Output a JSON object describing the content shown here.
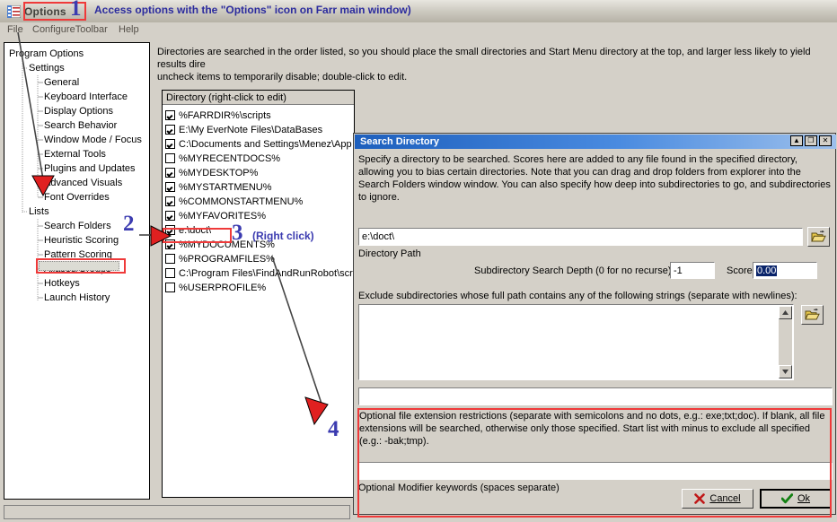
{
  "toolbar": {
    "options_label": "Options",
    "options_icon": "checklist-options-icon"
  },
  "annotations": {
    "one": {
      "number": "1",
      "text": "Access options with the \"Options\" icon on Farr main window)"
    },
    "two": {
      "number": "2"
    },
    "three": {
      "number": "3",
      "text": "(Right click)"
    },
    "four": {
      "number": "4"
    }
  },
  "menubar": {
    "items": [
      {
        "label": "File"
      },
      {
        "label": "ConfigureToolbar"
      },
      {
        "label": "Help"
      }
    ]
  },
  "tree": {
    "nodes": [
      {
        "label": "Program Options",
        "depth": 0
      },
      {
        "label": "Settings",
        "depth": 1
      },
      {
        "label": "General",
        "depth": 2
      },
      {
        "label": "Keyboard Interface",
        "depth": 2
      },
      {
        "label": "Display Options",
        "depth": 2
      },
      {
        "label": "Search Behavior",
        "depth": 2
      },
      {
        "label": "Window Mode / Focus",
        "depth": 2
      },
      {
        "label": "External Tools",
        "depth": 2
      },
      {
        "label": "Plugins and Updates",
        "depth": 2
      },
      {
        "label": "Advanced Visuals",
        "depth": 2
      },
      {
        "label": "Font Overrides",
        "depth": 2
      },
      {
        "label": "Lists",
        "depth": 1
      },
      {
        "label": "Search Folders",
        "depth": 2
      },
      {
        "label": "Heuristic Scoring",
        "depth": 2
      },
      {
        "label": "Pattern Scoring",
        "depth": 2
      },
      {
        "label": "Aliases/Groups",
        "depth": 2
      },
      {
        "label": "Hotkeys",
        "depth": 2
      },
      {
        "label": "Launch History",
        "depth": 2
      }
    ],
    "selected": "Search Folders"
  },
  "main": {
    "description": "Directories are searched in the order listed, so you should place the small directories and Start Menu directory at the top, and larger less likely to yield results dire",
    "description_line2": "uncheck items to temporarily disable; double-click to edit.",
    "dirlist_header": "Directory (right-click to edit)",
    "directories": [
      {
        "label": "%FARRDIR%\\scripts",
        "checked": true
      },
      {
        "label": "E:\\My EverNote Files\\DataBases",
        "checked": true
      },
      {
        "label": "C:\\Documents and Settings\\Menez\\App",
        "checked": true
      },
      {
        "label": "%MYRECENTDOCS%",
        "checked": false
      },
      {
        "label": "%MYDESKTOP%",
        "checked": true
      },
      {
        "label": "%MYSTARTMENU%",
        "checked": true
      },
      {
        "label": "%COMMONSTARTMENU%",
        "checked": true
      },
      {
        "label": "%MYFAVORITES%",
        "checked": true
      },
      {
        "label": "e:\\doct\\",
        "checked": true
      },
      {
        "label": "%MYDOCUMENTS%",
        "checked": true
      },
      {
        "label": "%PROGRAMFILES%",
        "checked": false
      },
      {
        "label": "C:\\Program Files\\FindAndRunRobot\\scr",
        "checked": false
      },
      {
        "label": "%USERPROFILE%",
        "checked": false
      }
    ]
  },
  "dialog": {
    "title": "Search Directory",
    "titlebar_buttons": [
      {
        "name": "rollup-icon",
        "glyph": "▲"
      },
      {
        "name": "pin-icon",
        "glyph": "❐"
      },
      {
        "name": "close-icon",
        "glyph": "✕"
      }
    ],
    "description": "Specify a directory to be searched. Scores here are added to any file found in the specified directory, allowing you to bias certain directories.  Note that you can drag and drop folders from explorer into the Search Folders window window.  You can also specify how deep into subdirectories to go, and subdirectories to ignore.",
    "path_value": "e:\\doct\\",
    "path_label": "Directory Path",
    "depth_label": "Subdirectory Search Depth (0 for no recurse):",
    "depth_value": "-1",
    "score_label": "Score:",
    "score_value": "0.00",
    "exclude_label": "Exclude subdirectories whose full path contains any of the following strings (separate with newlines):",
    "exclude_value": "",
    "ext_value": "",
    "ext_help": "Optional file extension restrictions (separate with semicolons and no dots, e.g.: exe;txt;doc).  If blank, all file extensions will be searched, otherwise only those specified.  Start list with minus to exclude all specified (e.g.: -bak;tmp).",
    "modifier_value": "",
    "modifier_label": "Optional Modifier keywords (spaces separate)",
    "cancel_label": "Cancel",
    "ok_label": "Ok",
    "browse_icon": "open-folder-icon"
  },
  "colors": {
    "annotation_red": "#ef3a3a",
    "annotation_blue": "#3b3bb0",
    "face": "#d4d0c8",
    "title_blue": "#1d5fbd"
  }
}
